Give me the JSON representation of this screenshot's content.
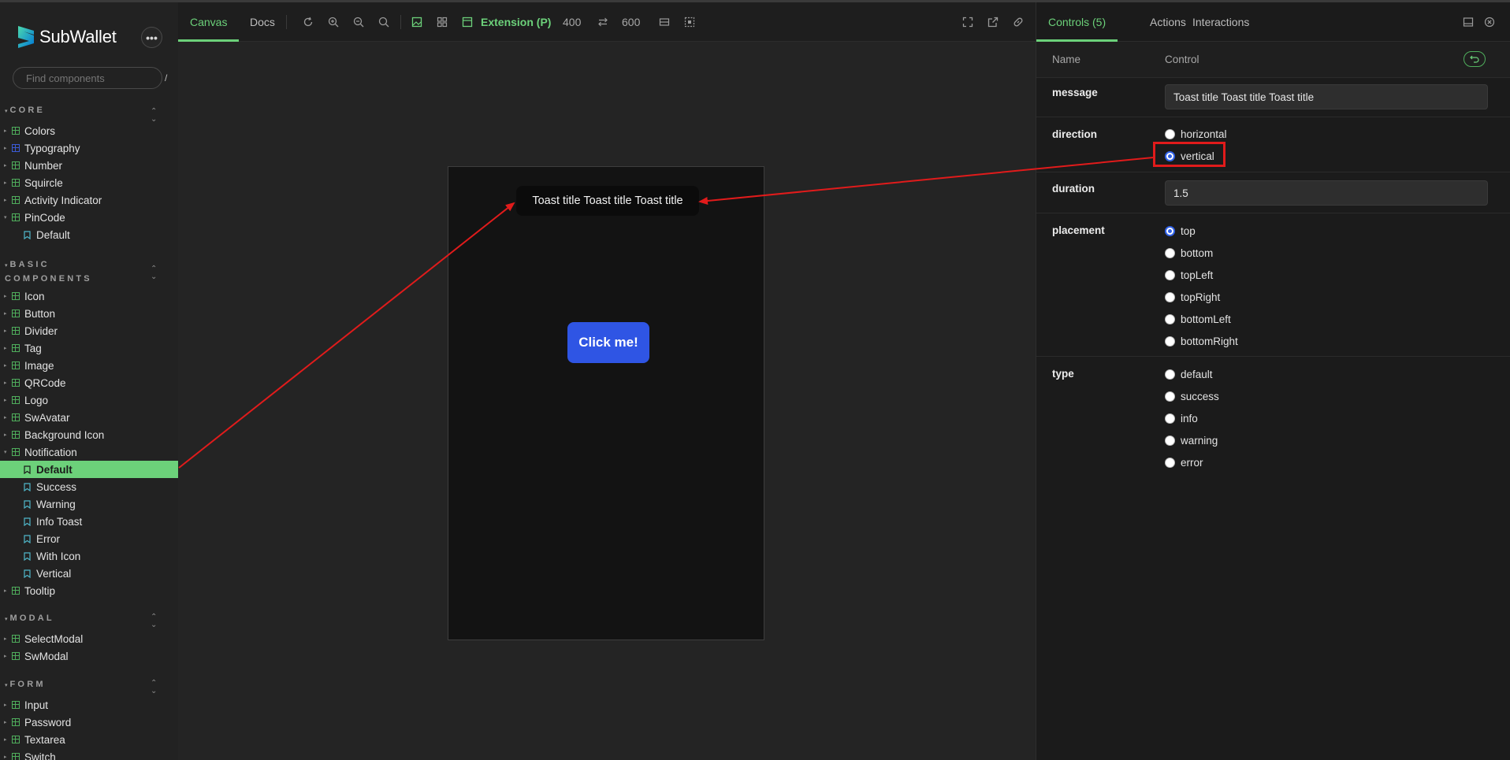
{
  "sidebar": {
    "brand": "SubWallet",
    "search_placeholder": "Find components",
    "search_kbd": "/",
    "sections": {
      "core": "CORE",
      "basic": "BASIC COMPONENTS",
      "modal": "MODAL",
      "form": "FORM"
    },
    "core_items": [
      "Colors",
      "Typography",
      "Number",
      "Squircle",
      "Activity Indicator",
      "PinCode"
    ],
    "pincode_story": "Default",
    "basic_items": [
      "Icon",
      "Button",
      "Divider",
      "Tag",
      "Image",
      "QRCode",
      "Logo",
      "SwAvatar",
      "Background Icon",
      "Notification"
    ],
    "notification_stories": [
      "Default",
      "Success",
      "Warning",
      "Info Toast",
      "Error",
      "With Icon",
      "Vertical"
    ],
    "tooltip": "Tooltip",
    "modal_items": [
      "SelectModal",
      "SwModal"
    ],
    "form_items": [
      "Input",
      "Password",
      "Textarea",
      "Switch"
    ]
  },
  "toolbar": {
    "tab_canvas": "Canvas",
    "tab_docs": "Docs",
    "viewport_label": "Extension (P)",
    "width": "400",
    "height": "600"
  },
  "canvas": {
    "toast_text": "Toast title Toast title Toast title",
    "button_label": "Click me!"
  },
  "panel": {
    "tab_controls": "Controls (5)",
    "tab_actions": "Actions",
    "tab_interactions": "Interactions",
    "header_name": "Name",
    "header_control": "Control",
    "message_label": "message",
    "message_value": "Toast title Toast title Toast title",
    "direction_label": "direction",
    "direction_options": [
      "horizontal",
      "vertical"
    ],
    "direction_selected": "vertical",
    "duration_label": "duration",
    "duration_value": "1.5",
    "placement_label": "placement",
    "placement_options": [
      "top",
      "bottom",
      "topLeft",
      "topRight",
      "bottomLeft",
      "bottomRight"
    ],
    "placement_selected": "top",
    "type_label": "type",
    "type_options": [
      "default",
      "success",
      "info",
      "warning",
      "error"
    ]
  },
  "colors": {
    "accent": "#6cd17a",
    "primary_button": "#2f55e4",
    "annotation": "#e11b1b"
  }
}
